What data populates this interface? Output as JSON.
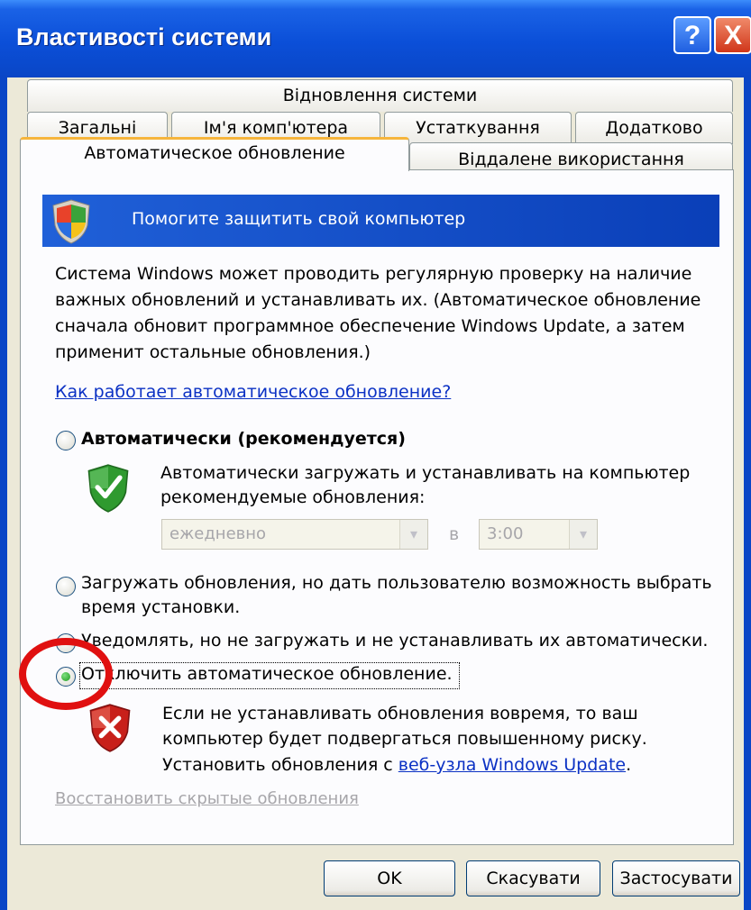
{
  "window": {
    "title": "Властивості системи",
    "help_glyph": "?",
    "close_glyph": "X"
  },
  "tabs": {
    "row1": [
      "Відновлення системи"
    ],
    "row2": [
      "Загальні",
      "Ім'я комп'ютера",
      "Устаткування",
      "Додатково"
    ],
    "row3": [
      "Автоматическое обновление",
      "Віддалене використання"
    ],
    "active": "Автоматическое обновление"
  },
  "banner": {
    "text": "Помогите защитить свой компьютер",
    "icon": "windows-security-shield-icon"
  },
  "description": "Система Windows может проводить регулярную проверку на наличие важных обновлений и устанавливать их. (Автоматическое обновление сначала обновит программное обеспечение Windows Update, а затем применит остальные обновления.)",
  "how_link": "Как работает автоматическое обновление?",
  "options": {
    "auto": {
      "label": "Автоматически (рекомендуется)",
      "checked": false,
      "icon": "green-check-shield-icon"
    },
    "auto_desc": "Автоматически загружать и устанавливать на компьютер рекомендуемые обновления:",
    "schedule": {
      "day": "ежедневно",
      "at_label": "в",
      "time": "3:00"
    },
    "download": {
      "label": "Загружать обновления, но дать пользователю возможность выбрать время установки.",
      "checked": false
    },
    "notify": {
      "label": "Уведомлять, но не загружать и не устанавливать их автоматически.",
      "checked": false
    },
    "off": {
      "label": "Отключить автоматическое обновление.",
      "checked": true,
      "icon": "red-x-shield-icon"
    }
  },
  "off_warning": "Если не устанавливать обновления вовремя, то ваш компьютер будет подвергаться повышенному риску.",
  "install_prefix": "Установить обновления с ",
  "install_link": "веб-узла Windows Update",
  "install_suffix": ".",
  "restore_link": "Восстановить скрытые обновления",
  "buttons": {
    "ok": "OK",
    "cancel": "Скасувати",
    "apply": "Застосувати"
  },
  "colors": {
    "titlebar": "#0a46c6",
    "banner": "#0a3fb8",
    "link": "#0b31c4",
    "highlight_circle": "#e01010"
  }
}
